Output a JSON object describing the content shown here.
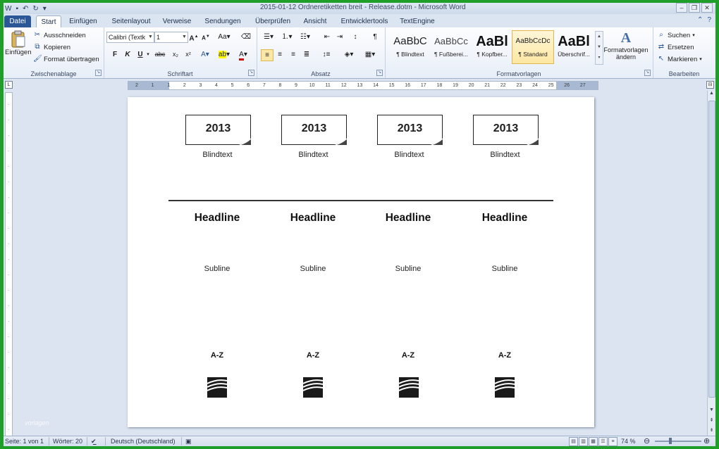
{
  "window": {
    "title": "2015-01-12 Ordneretiketten breit - Release.dotm - Microsoft Word"
  },
  "tabs": [
    {
      "label": "Datei"
    },
    {
      "label": "Start"
    },
    {
      "label": "Einfügen"
    },
    {
      "label": "Seitenlayout"
    },
    {
      "label": "Verweise"
    },
    {
      "label": "Sendungen"
    },
    {
      "label": "Überprüfen"
    },
    {
      "label": "Ansicht"
    },
    {
      "label": "Entwicklertools"
    },
    {
      "label": "TextEngine"
    }
  ],
  "clipboard": {
    "paste": "Einfügen",
    "cut": "Ausschneiden",
    "copy": "Kopieren",
    "format_painter": "Format übertragen",
    "group_label": "Zwischenablage"
  },
  "font": {
    "font_name": "Calibri (Textk",
    "font_size": "1",
    "group_label": "Schriftart"
  },
  "paragraph": {
    "group_label": "Absatz"
  },
  "styles": {
    "items": [
      {
        "sample": "AaBbC",
        "name": "¶ Blindtext"
      },
      {
        "sample": "AaBbCc",
        "name": "¶ Fußberei..."
      },
      {
        "sample": "AaBl",
        "name": "¶ Kopfber..."
      },
      {
        "sample": "AaBbCcDc",
        "name": "¶ Standard"
      },
      {
        "sample": "AaBl",
        "name": "Überschrif..."
      }
    ],
    "change_styles": "Formatvorlagen ändern",
    "group_label": "Formatvorlagen"
  },
  "editing": {
    "find": "Suchen",
    "replace": "Ersetzen",
    "select": "Markieren",
    "group_label": "Bearbeiten"
  },
  "ruler": {
    "numbers": [
      "2",
      "1",
      "1",
      "2",
      "3",
      "4",
      "5",
      "6",
      "7",
      "8",
      "9",
      "10",
      "11",
      "12",
      "13",
      "14",
      "15",
      "16",
      "17",
      "18",
      "19",
      "20",
      "21",
      "22",
      "23",
      "24",
      "25",
      "26",
      "27"
    ]
  },
  "document": {
    "labels": [
      {
        "year": "2013",
        "caption": "Blindtext",
        "headline": "Headline",
        "subline": "Subline",
        "az": "A-Z"
      },
      {
        "year": "2013",
        "caption": "Blindtext",
        "headline": "Headline",
        "subline": "Subline",
        "az": "A-Z"
      },
      {
        "year": "2013",
        "caption": "Blindtext",
        "headline": "Headline",
        "subline": "Subline",
        "az": "A-Z"
      },
      {
        "year": "2013",
        "caption": "Blindtext",
        "headline": "Headline",
        "subline": "Subline",
        "az": "A-Z"
      }
    ]
  },
  "watermark": "vorlagen",
  "statusbar": {
    "page": "Seite: 1 von 1",
    "words": "Wörter: 20",
    "language": "Deutsch (Deutschland)",
    "zoom": "74 %"
  }
}
